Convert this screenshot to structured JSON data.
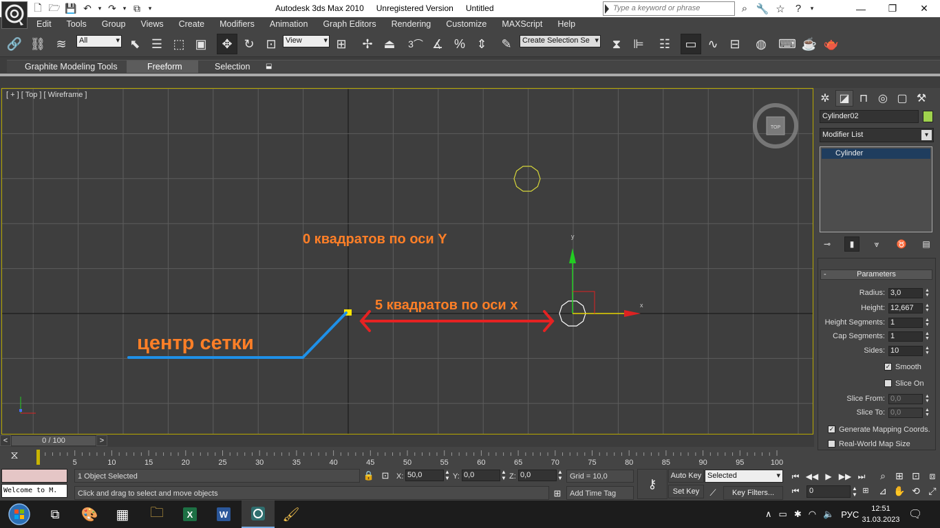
{
  "titlebar": {
    "app": "Autodesk 3ds Max  2010",
    "registration": "Unregistered Version",
    "file": "Untitled",
    "search_placeholder": "Type a keyword or phrase",
    "min": "—",
    "max": "❐",
    "close": "✕"
  },
  "menu": [
    "Edit",
    "Tools",
    "Group",
    "Views",
    "Create",
    "Modifiers",
    "Animation",
    "Graph Editors",
    "Rendering",
    "Customize",
    "MAXScript",
    "Help"
  ],
  "toolbar": {
    "selection_filter": "All",
    "ref_coord": "View",
    "named_selection": "Create Selection Se",
    "snap_3": "3"
  },
  "ribbon": {
    "tabs": [
      "Graphite Modeling Tools",
      "Freeform",
      "Selection"
    ],
    "active_tab": 1
  },
  "viewport": {
    "label": "[ + ] [ Top ] [ Wireframe ]",
    "viewcube_label": "TOP",
    "gizmo_x": "x",
    "gizmo_y": "y",
    "annotations": {
      "y_axis": "0 квадратов по оси Y",
      "x_axis": "5 квадратов по оси x",
      "center": "центр сетки"
    },
    "colors": {
      "y_text": "#ff7f27",
      "x_text": "#ff7f27",
      "center_text": "#ff7f27",
      "center_line": "#1e90e8",
      "arrow": "#e52222",
      "selected": "#ffffff",
      "other_object": "#d6d63a",
      "gizmo_y": "#22cc22",
      "gizmo_x": "#dd2222"
    }
  },
  "command_panel": {
    "object_name": "Cylinder02",
    "object_color": "#9fd24d",
    "modifier_list": "Modifier List",
    "stack": [
      "Cylinder"
    ],
    "rollout_title": "Parameters",
    "rollout_toggle": "-",
    "params": [
      {
        "label": "Radius:",
        "value": "3,0"
      },
      {
        "label": "Height:",
        "value": "12,667"
      },
      {
        "label": "Height Segments:",
        "value": "1"
      },
      {
        "label": "Cap Segments:",
        "value": "1"
      },
      {
        "label": "Sides:",
        "value": "10"
      }
    ],
    "smooth": {
      "label": "Smooth",
      "checked": true
    },
    "slice_on": {
      "label": "Slice On",
      "checked": false
    },
    "slice_from": {
      "label": "Slice From:",
      "value": "0,0"
    },
    "slice_to": {
      "label": "Slice To:",
      "value": "0,0"
    },
    "gen_mapping": {
      "label": "Generate Mapping Coords.",
      "checked": true
    },
    "real_world": {
      "label": "Real-World Map Size",
      "checked": false
    }
  },
  "timeslider": {
    "position": "0 / 100",
    "prev": "<",
    "next": ">",
    "current_frame": 0,
    "total_frames": 100
  },
  "trackbar": {
    "ticks": [
      "5",
      "10",
      "15",
      "20",
      "25",
      "30",
      "35",
      "40",
      "45",
      "50",
      "55",
      "60",
      "65",
      "70",
      "75",
      "80",
      "85",
      "90",
      "95",
      "100"
    ]
  },
  "status": {
    "maxscript_output": "Welcome to M.",
    "selection": "1 Object Selected",
    "prompt": "Click and drag to select and move objects",
    "x_label": "X:",
    "y_label": "Y:",
    "z_label": "Z:",
    "x": "50,0",
    "y": "0,0",
    "z": "0,0",
    "grid": "Grid = 10,0",
    "add_time_tag": "Add Time Tag",
    "auto_key": "Auto Key",
    "set_key": "Set Key",
    "key_mode": "Selected",
    "key_filters": "Key Filters...",
    "frame": "0"
  },
  "taskbar": {
    "language": "РУС",
    "time": "12:51",
    "date": "31.03.2023"
  }
}
